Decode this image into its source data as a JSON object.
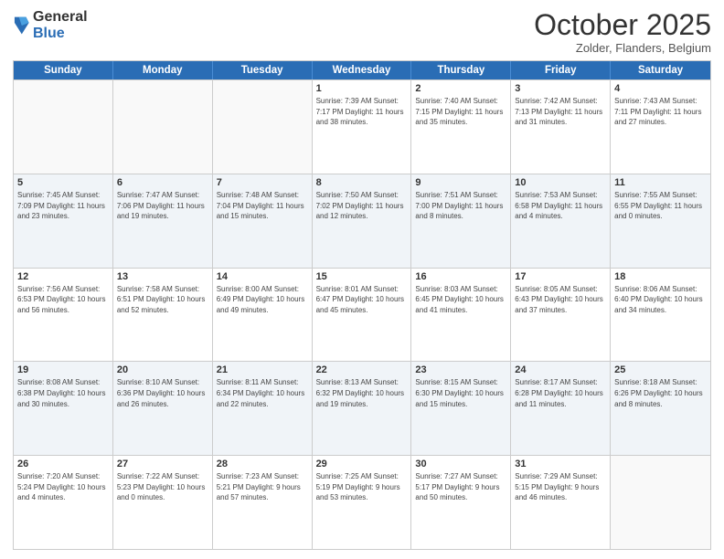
{
  "header": {
    "logo_general": "General",
    "logo_blue": "Blue",
    "month_title": "October 2025",
    "subtitle": "Zolder, Flanders, Belgium"
  },
  "weekdays": [
    "Sunday",
    "Monday",
    "Tuesday",
    "Wednesday",
    "Thursday",
    "Friday",
    "Saturday"
  ],
  "rows": [
    [
      {
        "day": "",
        "info": ""
      },
      {
        "day": "",
        "info": ""
      },
      {
        "day": "",
        "info": ""
      },
      {
        "day": "1",
        "info": "Sunrise: 7:39 AM\nSunset: 7:17 PM\nDaylight: 11 hours\nand 38 minutes."
      },
      {
        "day": "2",
        "info": "Sunrise: 7:40 AM\nSunset: 7:15 PM\nDaylight: 11 hours\nand 35 minutes."
      },
      {
        "day": "3",
        "info": "Sunrise: 7:42 AM\nSunset: 7:13 PM\nDaylight: 11 hours\nand 31 minutes."
      },
      {
        "day": "4",
        "info": "Sunrise: 7:43 AM\nSunset: 7:11 PM\nDaylight: 11 hours\nand 27 minutes."
      }
    ],
    [
      {
        "day": "5",
        "info": "Sunrise: 7:45 AM\nSunset: 7:09 PM\nDaylight: 11 hours\nand 23 minutes."
      },
      {
        "day": "6",
        "info": "Sunrise: 7:47 AM\nSunset: 7:06 PM\nDaylight: 11 hours\nand 19 minutes."
      },
      {
        "day": "7",
        "info": "Sunrise: 7:48 AM\nSunset: 7:04 PM\nDaylight: 11 hours\nand 15 minutes."
      },
      {
        "day": "8",
        "info": "Sunrise: 7:50 AM\nSunset: 7:02 PM\nDaylight: 11 hours\nand 12 minutes."
      },
      {
        "day": "9",
        "info": "Sunrise: 7:51 AM\nSunset: 7:00 PM\nDaylight: 11 hours\nand 8 minutes."
      },
      {
        "day": "10",
        "info": "Sunrise: 7:53 AM\nSunset: 6:58 PM\nDaylight: 11 hours\nand 4 minutes."
      },
      {
        "day": "11",
        "info": "Sunrise: 7:55 AM\nSunset: 6:55 PM\nDaylight: 11 hours\nand 0 minutes."
      }
    ],
    [
      {
        "day": "12",
        "info": "Sunrise: 7:56 AM\nSunset: 6:53 PM\nDaylight: 10 hours\nand 56 minutes."
      },
      {
        "day": "13",
        "info": "Sunrise: 7:58 AM\nSunset: 6:51 PM\nDaylight: 10 hours\nand 52 minutes."
      },
      {
        "day": "14",
        "info": "Sunrise: 8:00 AM\nSunset: 6:49 PM\nDaylight: 10 hours\nand 49 minutes."
      },
      {
        "day": "15",
        "info": "Sunrise: 8:01 AM\nSunset: 6:47 PM\nDaylight: 10 hours\nand 45 minutes."
      },
      {
        "day": "16",
        "info": "Sunrise: 8:03 AM\nSunset: 6:45 PM\nDaylight: 10 hours\nand 41 minutes."
      },
      {
        "day": "17",
        "info": "Sunrise: 8:05 AM\nSunset: 6:43 PM\nDaylight: 10 hours\nand 37 minutes."
      },
      {
        "day": "18",
        "info": "Sunrise: 8:06 AM\nSunset: 6:40 PM\nDaylight: 10 hours\nand 34 minutes."
      }
    ],
    [
      {
        "day": "19",
        "info": "Sunrise: 8:08 AM\nSunset: 6:38 PM\nDaylight: 10 hours\nand 30 minutes."
      },
      {
        "day": "20",
        "info": "Sunrise: 8:10 AM\nSunset: 6:36 PM\nDaylight: 10 hours\nand 26 minutes."
      },
      {
        "day": "21",
        "info": "Sunrise: 8:11 AM\nSunset: 6:34 PM\nDaylight: 10 hours\nand 22 minutes."
      },
      {
        "day": "22",
        "info": "Sunrise: 8:13 AM\nSunset: 6:32 PM\nDaylight: 10 hours\nand 19 minutes."
      },
      {
        "day": "23",
        "info": "Sunrise: 8:15 AM\nSunset: 6:30 PM\nDaylight: 10 hours\nand 15 minutes."
      },
      {
        "day": "24",
        "info": "Sunrise: 8:17 AM\nSunset: 6:28 PM\nDaylight: 10 hours\nand 11 minutes."
      },
      {
        "day": "25",
        "info": "Sunrise: 8:18 AM\nSunset: 6:26 PM\nDaylight: 10 hours\nand 8 minutes."
      }
    ],
    [
      {
        "day": "26",
        "info": "Sunrise: 7:20 AM\nSunset: 5:24 PM\nDaylight: 10 hours\nand 4 minutes."
      },
      {
        "day": "27",
        "info": "Sunrise: 7:22 AM\nSunset: 5:23 PM\nDaylight: 10 hours\nand 0 minutes."
      },
      {
        "day": "28",
        "info": "Sunrise: 7:23 AM\nSunset: 5:21 PM\nDaylight: 9 hours\nand 57 minutes."
      },
      {
        "day": "29",
        "info": "Sunrise: 7:25 AM\nSunset: 5:19 PM\nDaylight: 9 hours\nand 53 minutes."
      },
      {
        "day": "30",
        "info": "Sunrise: 7:27 AM\nSunset: 5:17 PM\nDaylight: 9 hours\nand 50 minutes."
      },
      {
        "day": "31",
        "info": "Sunrise: 7:29 AM\nSunset: 5:15 PM\nDaylight: 9 hours\nand 46 minutes."
      },
      {
        "day": "",
        "info": ""
      }
    ]
  ]
}
